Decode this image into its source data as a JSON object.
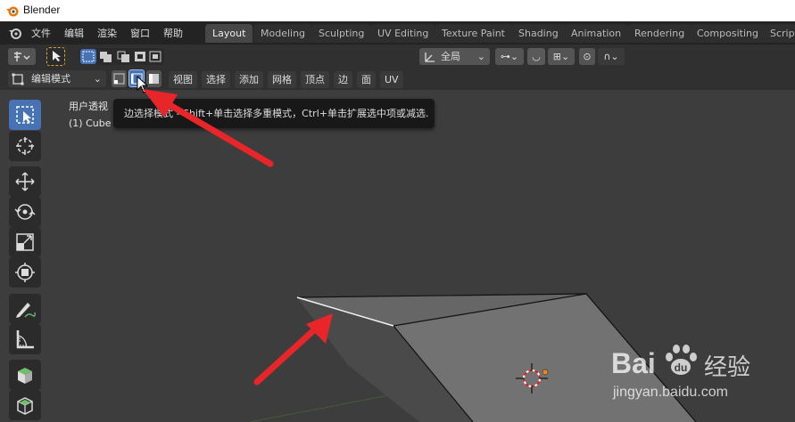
{
  "window": {
    "title": "Blender"
  },
  "menu": [
    {
      "label": "文件"
    },
    {
      "label": "编辑"
    },
    {
      "label": "渲染"
    },
    {
      "label": "窗口"
    },
    {
      "label": "帮助"
    }
  ],
  "workspaces": [
    {
      "label": "Layout",
      "active": true
    },
    {
      "label": "Modeling"
    },
    {
      "label": "Sculpting"
    },
    {
      "label": "UV Editing"
    },
    {
      "label": "Texture Paint"
    },
    {
      "label": "Shading"
    },
    {
      "label": "Animation"
    },
    {
      "label": "Rendering"
    },
    {
      "label": "Compositing"
    },
    {
      "label": "Script"
    }
  ],
  "header1": {
    "transform_orientation": "全局"
  },
  "header2": {
    "mode": "编辑模式",
    "menus": [
      {
        "label": "视图"
      },
      {
        "label": "选择"
      },
      {
        "label": "添加"
      },
      {
        "label": "网格"
      },
      {
        "label": "顶点"
      },
      {
        "label": "边"
      },
      {
        "label": "面"
      },
      {
        "label": "UV"
      }
    ],
    "select_modes": [
      "vertex-select",
      "edge-select",
      "face-select"
    ],
    "active_select_mode": "edge-select"
  },
  "viewport": {
    "view_name": "用户透视",
    "object_name": "(1) Cube"
  },
  "tooltip": {
    "text": "边选择模式 - Shift+单击选择多重模式，Ctrl+单击扩展选中项或减选."
  },
  "tools": [
    {
      "icon": "select-box-icon",
      "active": true
    },
    {
      "icon": "cursor-icon"
    },
    {
      "icon": "move-icon"
    },
    {
      "icon": "rotate-icon"
    },
    {
      "icon": "scale-icon"
    },
    {
      "icon": "transform-icon"
    },
    {
      "icon": "annotate-icon"
    },
    {
      "icon": "measure-icon"
    },
    {
      "icon": "add-cube-icon"
    },
    {
      "icon": "extrude-icon"
    }
  ],
  "watermark": {
    "brand": "Bai",
    "brand2": "du",
    "cn": "经验",
    "url": "jingyan.baidu.com"
  },
  "colors": {
    "accent": "#4772b3",
    "arrow": "#e8262a",
    "header": "#303030",
    "viewport": "#3d3d3d"
  }
}
